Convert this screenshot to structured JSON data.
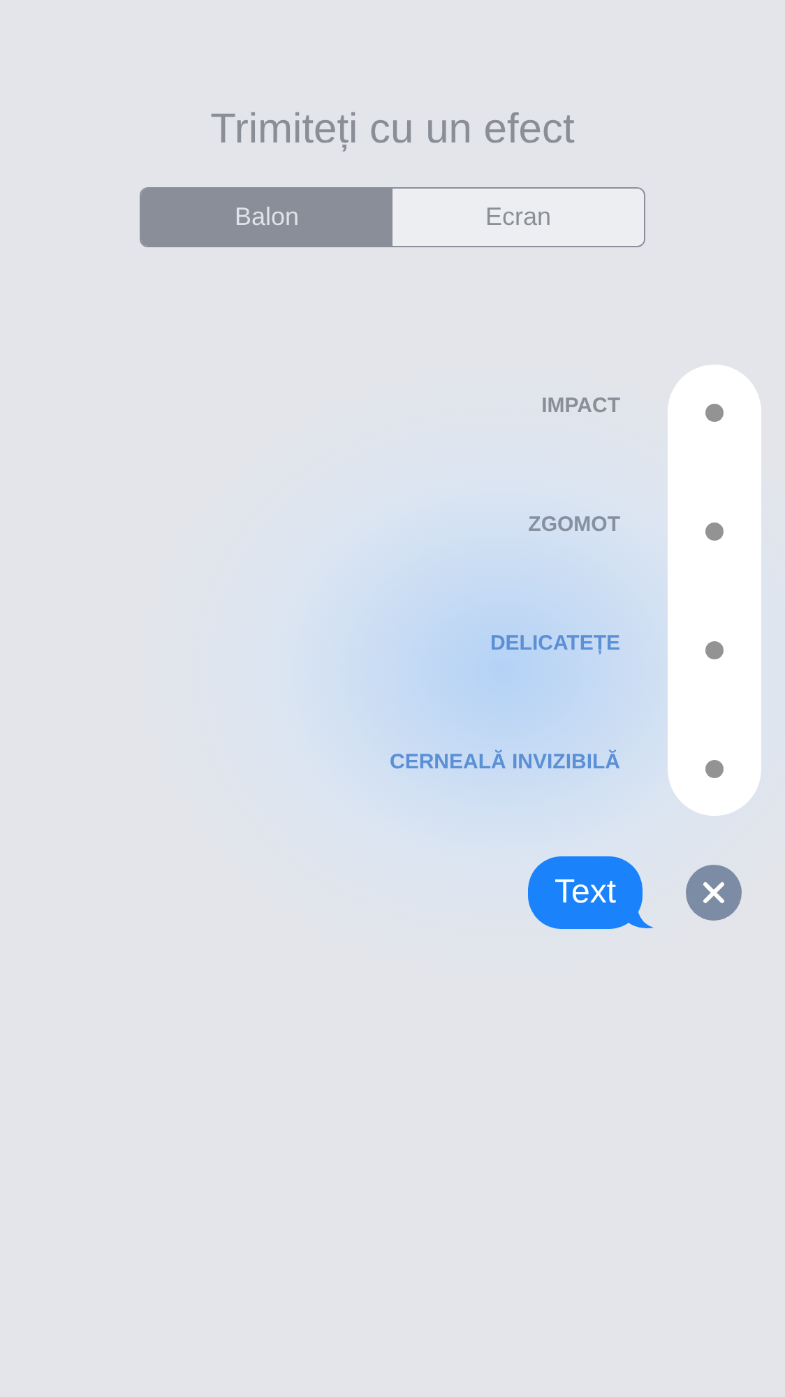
{
  "title": "Trimiteți cu un efect",
  "segments": [
    {
      "label": "Balon",
      "selected": true
    },
    {
      "label": "Ecran",
      "selected": false
    }
  ],
  "effects": [
    {
      "label": "IMPACT",
      "color": "#8a8e98"
    },
    {
      "label": "ZGOMOT",
      "color": "#8690a0"
    },
    {
      "label": "DELICATEȚE",
      "color": "#5b8fd6"
    },
    {
      "label": "CERNEALĂ INVIZIBILĂ",
      "color": "#5b8fd6"
    }
  ],
  "message": {
    "text": "Text"
  }
}
